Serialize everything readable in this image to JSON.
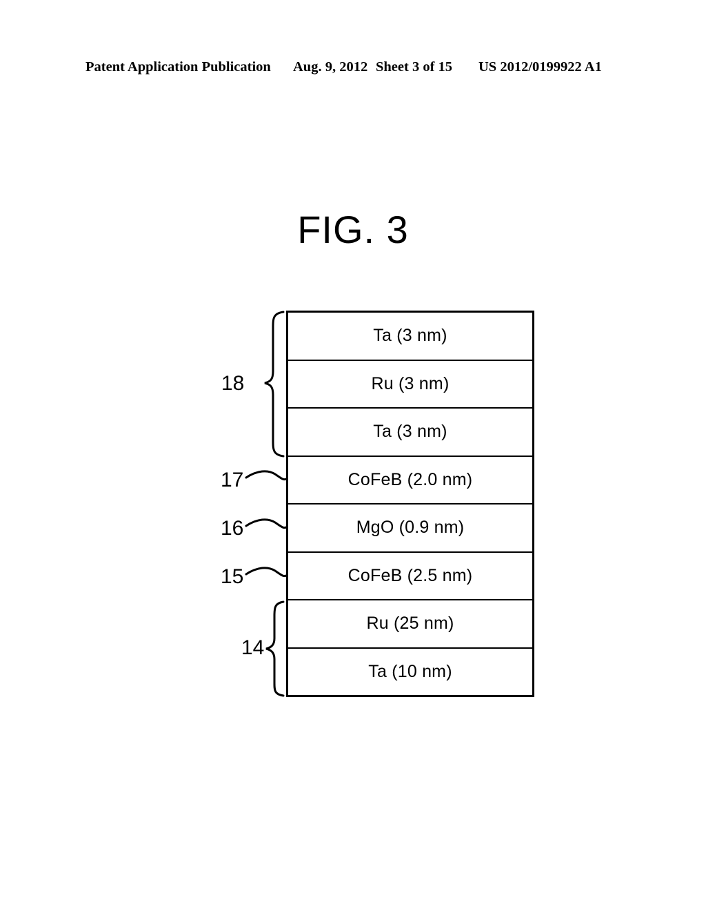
{
  "header": {
    "publication": "Patent Application Publication",
    "date": "Aug. 9, 2012",
    "sheet": "Sheet 3 of 15",
    "number": "US 2012/0199922 A1"
  },
  "figure": {
    "title": "FIG. 3",
    "type": "layer-stack-cross-section",
    "layers": [
      {
        "id": "layer-ta-3nm-top",
        "label": "Ta (3 nm)"
      },
      {
        "id": "layer-ru-3nm",
        "label": "Ru (3 nm)"
      },
      {
        "id": "layer-ta-3nm-lower",
        "label": "Ta (3 nm)"
      },
      {
        "id": "layer-cofeb-20nm",
        "label": "CoFeB (2.0 nm)"
      },
      {
        "id": "layer-mgo-09nm",
        "label": "MgO (0.9 nm)"
      },
      {
        "id": "layer-cofeb-25nm",
        "label": "CoFeB (2.5 nm)"
      },
      {
        "id": "layer-ru-25nm",
        "label": "Ru (25 nm)"
      },
      {
        "id": "layer-ta-10nm",
        "label": "Ta (10 nm)"
      }
    ],
    "reference_numerals": [
      {
        "id": "ref-18",
        "label": "18",
        "type": "brace",
        "spans": [
          "layer-ta-3nm-top",
          "layer-ru-3nm",
          "layer-ta-3nm-lower"
        ]
      },
      {
        "id": "ref-17",
        "label": "17",
        "type": "leader",
        "spans": [
          "layer-cofeb-20nm"
        ]
      },
      {
        "id": "ref-16",
        "label": "16",
        "type": "leader",
        "spans": [
          "layer-mgo-09nm"
        ]
      },
      {
        "id": "ref-15",
        "label": "15",
        "type": "leader",
        "spans": [
          "layer-cofeb-25nm"
        ]
      },
      {
        "id": "ref-14",
        "label": "14",
        "type": "brace",
        "spans": [
          "layer-ru-25nm",
          "layer-ta-10nm"
        ]
      }
    ]
  },
  "colors": {
    "ink": "#000000",
    "page": "#ffffff"
  }
}
